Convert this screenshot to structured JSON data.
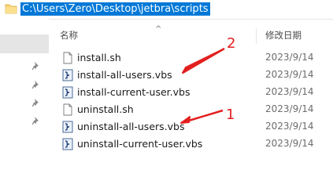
{
  "address": {
    "path": "C:\\Users\\Zero\\Desktop\\jetbra\\scripts"
  },
  "header": {
    "name_label": "名称",
    "date_label": "修改日期"
  },
  "files": [
    {
      "name": "install.sh",
      "date": "2023/9/14",
      "icon": "document-icon"
    },
    {
      "name": "install-all-users.vbs",
      "date": "2023/9/14",
      "icon": "vbscript-icon"
    },
    {
      "name": "install-current-user.vbs",
      "date": "2023/9/14",
      "icon": "vbscript-icon"
    },
    {
      "name": "uninstall.sh",
      "date": "2023/9/14",
      "icon": "document-icon"
    },
    {
      "name": "uninstall-all-users.vbs",
      "date": "2023/9/14",
      "icon": "vbscript-icon"
    },
    {
      "name": "uninstall-current-user.vbs",
      "date": "2023/9/14",
      "icon": "vbscript-icon"
    }
  ],
  "annotations": [
    {
      "number": "2",
      "color": "#e31f1f"
    },
    {
      "number": "1",
      "color": "#e31f1f"
    }
  ],
  "colors": {
    "selection": "#0078d7",
    "annotation": "#e31f1f"
  }
}
